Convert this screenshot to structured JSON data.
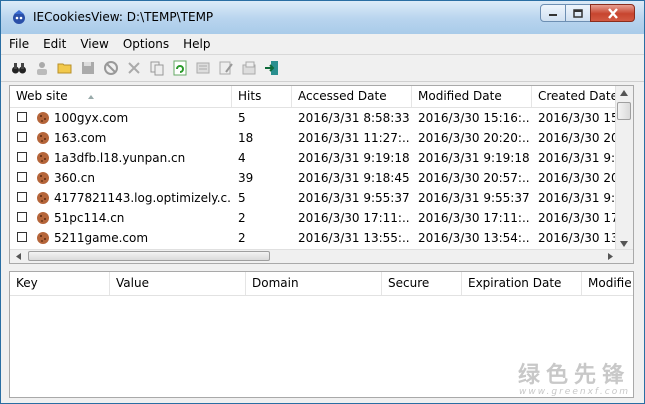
{
  "window": {
    "title": "IECookiesView:  D:\\TEMP\\TEMP"
  },
  "menu": [
    "File",
    "Edit",
    "View",
    "Options",
    "Help"
  ],
  "toolbar": {
    "icons": [
      "find-icon",
      "user-icon",
      "folder-icon",
      "save-icon",
      "block-icon",
      "delete-icon",
      "copy-icon",
      "refresh-icon",
      "edit-cookie-icon",
      "edit-icon",
      "properties-icon",
      "exit-icon"
    ]
  },
  "cookies_table": {
    "columns": [
      "Web site",
      "Hits",
      "Accessed Date",
      "Modified Date",
      "Created Date"
    ],
    "rows": [
      {
        "site": "100gyx.com",
        "hits": "5",
        "accessed": "2016/3/31 8:58:33",
        "modified": "2016/3/30 15:16:...",
        "created": "2016/3/30 15:"
      },
      {
        "site": "163.com",
        "hits": "18",
        "accessed": "2016/3/31 11:27:...",
        "modified": "2016/3/30 20:20:...",
        "created": "2016/3/30 20:"
      },
      {
        "site": "1a3dfb.l18.yunpan.cn",
        "hits": "4",
        "accessed": "2016/3/31 9:19:18",
        "modified": "2016/3/31 9:19:18",
        "created": "2016/3/31 9:1"
      },
      {
        "site": "360.cn",
        "hits": "39",
        "accessed": "2016/3/31 9:18:45",
        "modified": "2016/3/30 20:57:...",
        "created": "2016/3/30 20:"
      },
      {
        "site": "4177821143.log.optimizely.c...",
        "hits": "5",
        "accessed": "2016/3/31 9:55:37",
        "modified": "2016/3/31 9:55:37",
        "created": "2016/3/31 9:5"
      },
      {
        "site": "51pc114.cn",
        "hits": "2",
        "accessed": "2016/3/30 17:11:...",
        "modified": "2016/3/30 17:11:...",
        "created": "2016/3/30 17:"
      },
      {
        "site": "5211game.com",
        "hits": "2",
        "accessed": "2016/3/31 13:55:...",
        "modified": "2016/3/30 13:54:...",
        "created": "2016/3/30 13:"
      }
    ]
  },
  "details_table": {
    "columns": [
      "Key",
      "Value",
      "Domain",
      "Secure",
      "Expiration Date",
      "Modifie"
    ]
  },
  "watermark": {
    "brand": "绿色先锋",
    "url": "www.greenxf.com"
  },
  "colors": {
    "title_bar": "#b8d4ee",
    "close_button": "#c7452f",
    "cookie": "#b5653a"
  }
}
